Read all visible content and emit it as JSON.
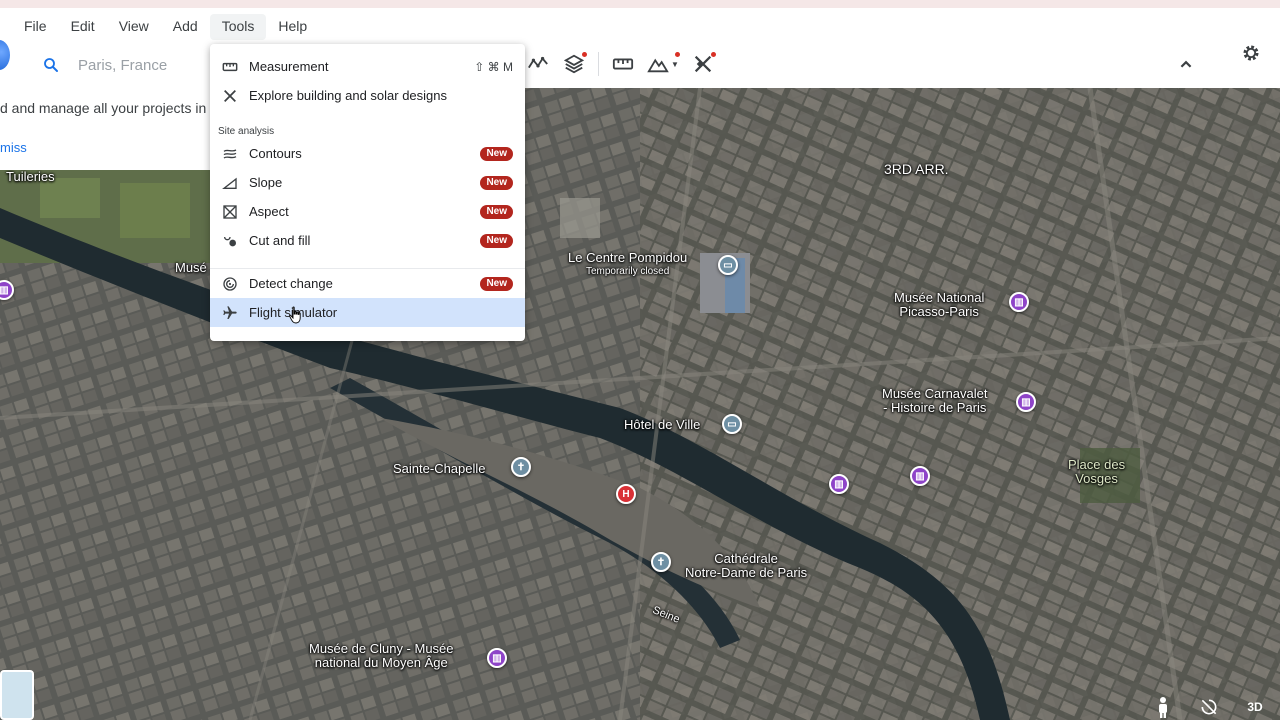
{
  "menubar": {
    "items": [
      {
        "label": "File",
        "name": "menu-file"
      },
      {
        "label": "Edit",
        "name": "menu-edit"
      },
      {
        "label": "View",
        "name": "menu-view"
      },
      {
        "label": "Add",
        "name": "menu-add"
      },
      {
        "label": "Tools",
        "name": "menu-tools"
      },
      {
        "label": "Help",
        "name": "menu-help"
      }
    ]
  },
  "search": {
    "placeholder": "Paris, France"
  },
  "projects_panel": {
    "text": "d and manage all your projects in",
    "dismiss": "miss"
  },
  "tools_menu": {
    "measurement": {
      "label": "Measurement",
      "shortcut": "⇧ ⌘ M"
    },
    "explore": {
      "label": "Explore building and solar designs"
    },
    "section_label": "Site analysis",
    "items": [
      {
        "label": "Contours",
        "badge": "New"
      },
      {
        "label": "Slope",
        "badge": "New"
      },
      {
        "label": "Aspect",
        "badge": "New"
      },
      {
        "label": "Cut and fill",
        "badge": "New"
      }
    ],
    "detect_change": {
      "label": "Detect change",
      "badge": "New"
    },
    "flight_simulator": {
      "label": "Flight simulator"
    }
  },
  "map_labels": {
    "tuileries": "Tuileries",
    "muse": "Musé",
    "arr3": "3RD ARR.",
    "pompidou": "Le Centre Pompidou",
    "pompidou_sub": "Temporarily closed",
    "picasso_1": "Musée National",
    "picasso_2": "Picasso-Paris",
    "carnavalet_1": "Musée Carnavalet",
    "carnavalet_2": "- Histoire de Paris",
    "hotel_de_ville": "Hôtel de Ville",
    "sainte_chapelle": "Sainte-Chapelle",
    "vosges_1": "Place des",
    "vosges_2": "Vosges",
    "notre_dame_1": "Cathédrale",
    "notre_dame_2": "Notre-Dame de Paris",
    "seine": "Seine",
    "cluny_1": "Musée de Cluny - Musée",
    "cluny_2": "national du Moyen Âge"
  },
  "bottom": {
    "view_3d": "3D"
  },
  "colors": {
    "badge": "#b3261e",
    "highlight": "#d2e3fc",
    "museum_poi": "#8e44c8",
    "hospital_poi": "#d93036",
    "link": "#1a73e8"
  },
  "icons": {
    "search": "search-icon",
    "settings": "gear-icon",
    "collapse": "chevron-up-icon"
  }
}
